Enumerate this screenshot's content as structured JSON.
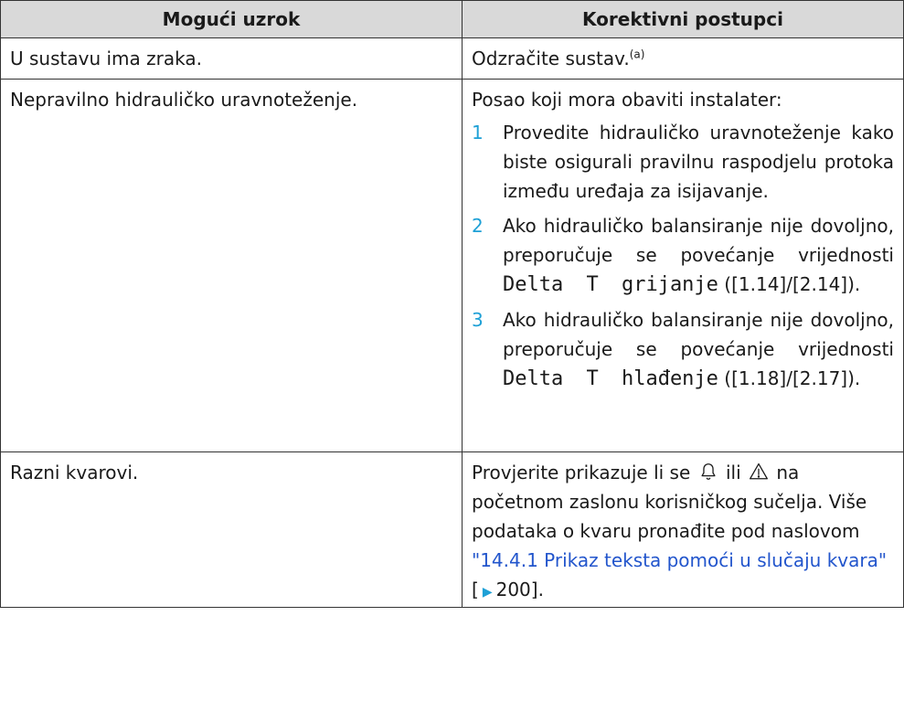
{
  "header": {
    "col_cause": "Mogući uzrok",
    "col_action": "Korektivni postupci"
  },
  "rows": [
    {
      "cause": "U sustavu ima zraka.",
      "action": "Odzračite sustav.",
      "note": "(a)"
    },
    {
      "cause": "Nepravilno hidrauličko uravnoteženje.",
      "intro": "Posao koji mora obaviti instalater:",
      "steps": [
        {
          "num": "1",
          "text": "Provedite hidrauličko uravnoteženje kako biste osigurali pravilnu raspodjelu protoka između uređaja za isijavanje."
        },
        {
          "num": "2",
          "text_before": "Ako hidrauličko balansiranje nije dovoljno, preporučuje se povećanje vrijednosti",
          "code": "Delta T grijanje",
          "text_after": "([1.14]/[2.14])."
        },
        {
          "num": "3",
          "text_before": "Ako hidrauličko balansiranje nije dovoljno, preporučuje se povećanje vrijednosti",
          "code": "Delta T hlađenje",
          "text_after": "([1.18]/[2.17])."
        }
      ]
    },
    {
      "cause": "Razni kvarovi.",
      "text_part1": "Provjerite prikazuje li se",
      "text_or": "ili",
      "text_part2": "na početnom zaslonu korisničkog sučelja. Više podataka o kvaru pronađite pod naslovom",
      "link_text": "\"14.4.1 Prikaz teksta pomoći u slučaju kvara\"",
      "page_ref_open": "[",
      "page_ref": "200",
      "page_ref_close": "]."
    }
  ],
  "icons": {
    "bell": "bell-icon",
    "warning": "warning-triangle-icon",
    "page-arrow": "page-ref-arrow-icon"
  },
  "colors": {
    "header_bg": "#d9d9d9",
    "step_number": "#1ea0d6",
    "link": "#2255cc",
    "border": "#333333"
  }
}
